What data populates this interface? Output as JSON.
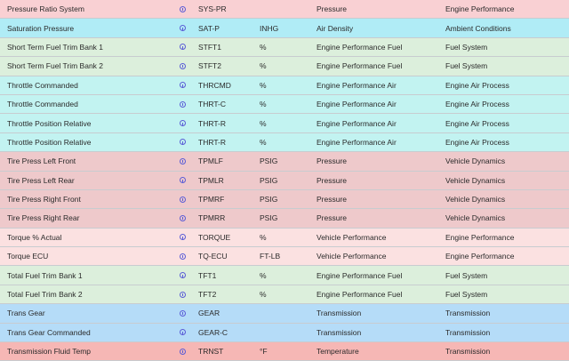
{
  "colors": {
    "pink": "#f9d0d3",
    "cyan": "#b0ecf6",
    "green": "#dcefdc",
    "teal": "#c2f3f1",
    "rose": "#eec9cb",
    "blush": "#fbe1e1",
    "blue": "#b5dcf8",
    "red": "#f6b7b5",
    "info_icon": "#5a5cd6"
  },
  "rows": [
    {
      "name": "Pressure Ratio System",
      "icon": "info-icon",
      "code": "SYS-PR",
      "unit": "",
      "category": "Pressure",
      "group": "Engine Performance",
      "color": "#f9d0d3"
    },
    {
      "name": "Saturation Pressure",
      "icon": "info-icon",
      "code": "SAT-P",
      "unit": "INHG",
      "category": "Air Density",
      "group": "Ambient Conditions",
      "color": "#b0ecf6"
    },
    {
      "name": "Short Term Fuel Trim Bank 1",
      "icon": "info-icon",
      "code": "STFT1",
      "unit": "%",
      "category": "Engine Performance Fuel",
      "group": "Fuel System",
      "color": "#dcefdc"
    },
    {
      "name": "Short Term Fuel Trim Bank 2",
      "icon": "info-icon",
      "code": "STFT2",
      "unit": "%",
      "category": "Engine Performance Fuel",
      "group": "Fuel System",
      "color": "#dcefdc"
    },
    {
      "name": "Throttle Commanded",
      "icon": "info-icon",
      "code": "THRCMD",
      "unit": "%",
      "category": "Engine Performance Air",
      "group": "Engine Air Process",
      "color": "#c2f3f1"
    },
    {
      "name": "Throttle Commanded",
      "icon": "info-icon",
      "code": "THRT-C",
      "unit": "%",
      "category": "Engine Performance Air",
      "group": "Engine Air Process",
      "color": "#c2f3f1"
    },
    {
      "name": "Throttle Position Relative",
      "icon": "info-icon",
      "code": "THRT-R",
      "unit": "%",
      "category": "Engine Performance Air",
      "group": "Engine Air Process",
      "color": "#c2f3f1"
    },
    {
      "name": "Throttle Position Relative",
      "icon": "info-icon",
      "code": "THRT-R",
      "unit": "%",
      "category": "Engine Performance Air",
      "group": "Engine Air Process",
      "color": "#c2f3f1"
    },
    {
      "name": "Tire Press Left Front",
      "icon": "info-icon",
      "code": "TPMLF",
      "unit": "PSIG",
      "category": "Pressure",
      "group": "Vehicle Dynamics",
      "color": "#eec9cb"
    },
    {
      "name": "Tire Press Left Rear",
      "icon": "info-icon",
      "code": "TPMLR",
      "unit": "PSIG",
      "category": "Pressure",
      "group": "Vehicle Dynamics",
      "color": "#eec9cb"
    },
    {
      "name": "Tire Press Right Front",
      "icon": "info-icon",
      "code": "TPMRF",
      "unit": "PSIG",
      "category": "Pressure",
      "group": "Vehicle Dynamics",
      "color": "#eec9cb"
    },
    {
      "name": "Tire Press Right Rear",
      "icon": "info-icon",
      "code": "TPMRR",
      "unit": "PSIG",
      "category": "Pressure",
      "group": "Vehicle Dynamics",
      "color": "#eec9cb"
    },
    {
      "name": "Torque % Actual",
      "icon": "info-icon",
      "code": "TORQUE",
      "unit": "%",
      "category": "Vehicle Performance",
      "group": "Engine Performance",
      "color": "#fbe1e1"
    },
    {
      "name": "Torque ECU",
      "icon": "info-icon",
      "code": "TQ-ECU",
      "unit": "FT-LB",
      "category": "Vehicle Performance",
      "group": "Engine Performance",
      "color": "#fbe1e1"
    },
    {
      "name": "Total Fuel Trim Bank 1",
      "icon": "info-icon",
      "code": "TFT1",
      "unit": "%",
      "category": "Engine Performance Fuel",
      "group": "Fuel System",
      "color": "#dcefdc"
    },
    {
      "name": "Total Fuel Trim Bank 2",
      "icon": "info-icon",
      "code": "TFT2",
      "unit": "%",
      "category": "Engine Performance Fuel",
      "group": "Fuel System",
      "color": "#dcefdc"
    },
    {
      "name": "Trans Gear",
      "icon": "info-icon",
      "code": "GEAR",
      "unit": "",
      "category": "Transmission",
      "group": "Transmission",
      "color": "#b5dcf8"
    },
    {
      "name": "Trans Gear Commanded",
      "icon": "info-icon",
      "code": "GEAR-C",
      "unit": "",
      "category": "Transmission",
      "group": "Transmission",
      "color": "#b5dcf8"
    },
    {
      "name": "Transmission Fluid Temp",
      "icon": "info-icon",
      "code": "TRNST",
      "unit": "°F",
      "category": "Temperature",
      "group": "Transmission",
      "color": "#f6b7b5"
    }
  ]
}
